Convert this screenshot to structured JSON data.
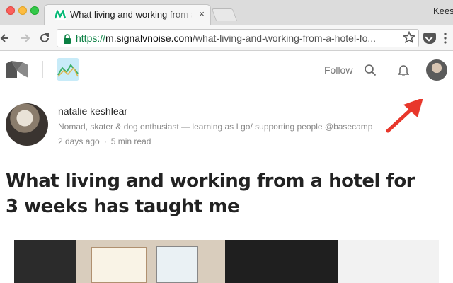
{
  "browser": {
    "tab": {
      "title": "What living and working from a",
      "close": "×"
    },
    "profile_name": "Kees",
    "url": {
      "protocol": "https://",
      "host": "m.signalvnoise.com",
      "path": "/what-living-and-working-from-a-hotel-fo..."
    },
    "icons": {
      "back": "arrow-left-icon",
      "forward": "arrow-right-icon",
      "reload": "reload-icon",
      "lock": "lock-icon",
      "star": "star-icon",
      "pocket": "pocket-icon",
      "menu": "menu-dots-icon"
    }
  },
  "header": {
    "follow_label": "Follow"
  },
  "author": {
    "name": "natalie keshlear",
    "bio": "Nomad, skater & dog enthusiast — learning as I go/ supporting people @basecamp",
    "published": "2 days ago",
    "read_time": "5 min read"
  },
  "article": {
    "title": "What living and working from a hotel for 3 weeks has taught me"
  },
  "colors": {
    "annotation_arrow": "#e8372b",
    "url_secure": "#0b8043",
    "medium_logo": "#555555"
  }
}
